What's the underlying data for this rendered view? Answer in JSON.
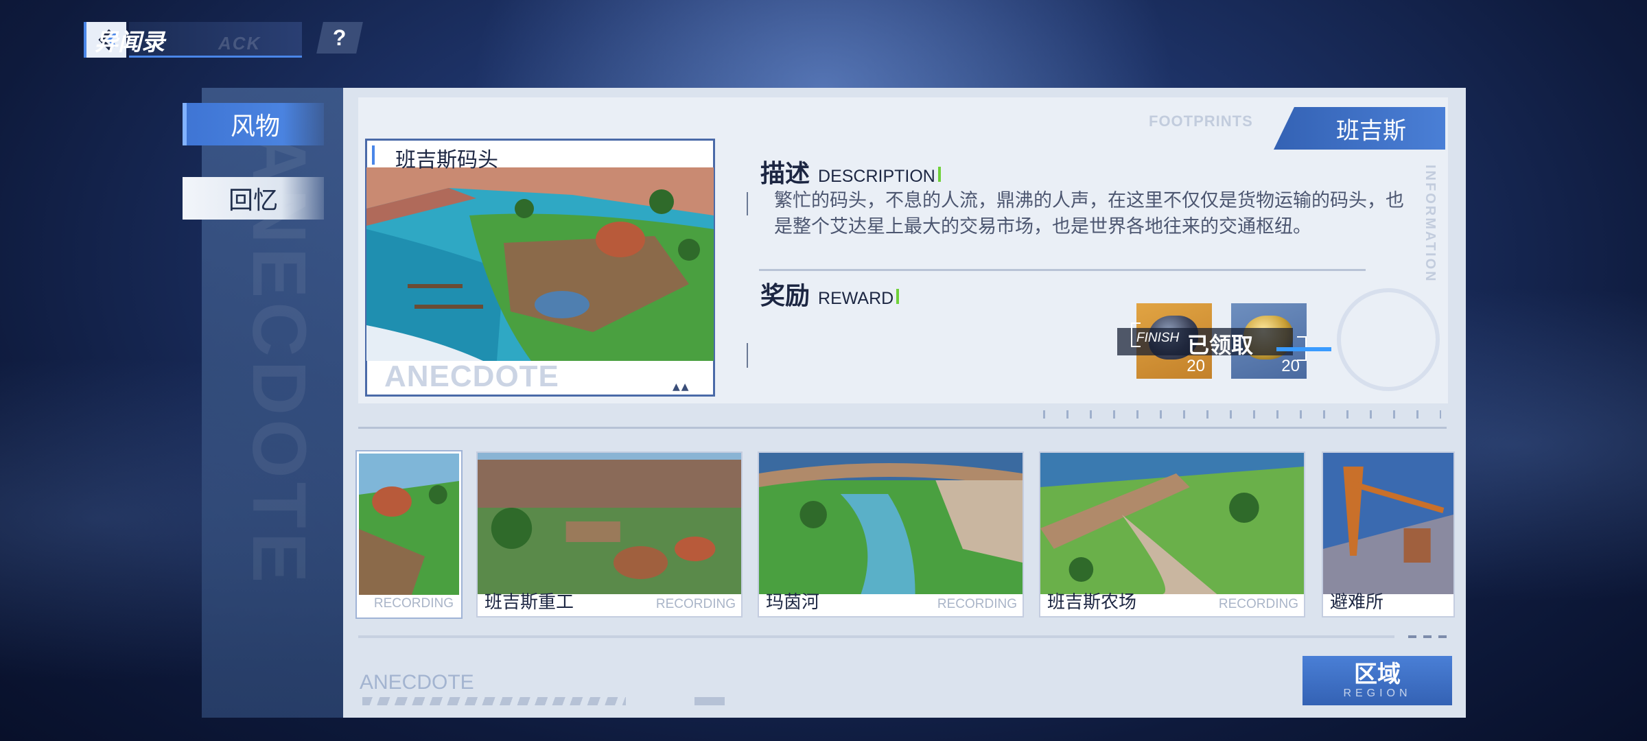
{
  "header": {
    "back_icon": "back-arrow-icon",
    "title": "异闻录",
    "title_ghost": "ACK",
    "help_label": "?"
  },
  "tabs": [
    {
      "label": "风物",
      "active": true
    },
    {
      "label": "回忆",
      "active": false
    }
  ],
  "sidebar_watermark": "ANECDOTE",
  "detail": {
    "footprints_label": "FOOTPRINTS",
    "region_badge": "班吉斯",
    "info_label": "INFORMATION",
    "preview": {
      "name": "班吉斯码头",
      "watermark": "ANECDOTE",
      "arrows": "▲▲"
    },
    "description": {
      "heading_cn": "描述",
      "heading_en": "DESCRIPTION",
      "text": "繁忙的码头，不息的人流，鼎沸的人声，在这里不仅仅是货物运输的码头，也是整个艾达星上最大的交易市场，也是世界各地往来的交通枢纽。"
    },
    "reward": {
      "heading_cn": "奖励",
      "heading_en": "REWARD",
      "items": [
        {
          "icon": "dark-ore-icon",
          "count": "20",
          "color": "#c3812a"
        },
        {
          "icon": "gold-ore-icon",
          "count": "20",
          "color": "#4a6aa0"
        }
      ],
      "claimed_label": "已领取",
      "finish_label": "FINISH"
    }
  },
  "thumbnails": [
    {
      "name": "",
      "recording": "RECORDING",
      "selected": true
    },
    {
      "name": "班吉斯重工",
      "recording": "RECORDING",
      "selected": false
    },
    {
      "name": "玛茵河",
      "recording": "RECORDING",
      "selected": false
    },
    {
      "name": "班吉斯农场",
      "recording": "RECORDING",
      "selected": false
    },
    {
      "name": "避难所",
      "recording": "",
      "selected": false
    }
  ],
  "footer": {
    "anecdote_label": "ANECDOTE",
    "region_button_cn": "区域",
    "region_button_en": "REGION"
  },
  "colors": {
    "accent": "#4a86e8",
    "panel": "#dbe3ee",
    "badge": "#3462b4",
    "reward_gold": "#c3812a",
    "green_tick": "#6fd13a"
  }
}
